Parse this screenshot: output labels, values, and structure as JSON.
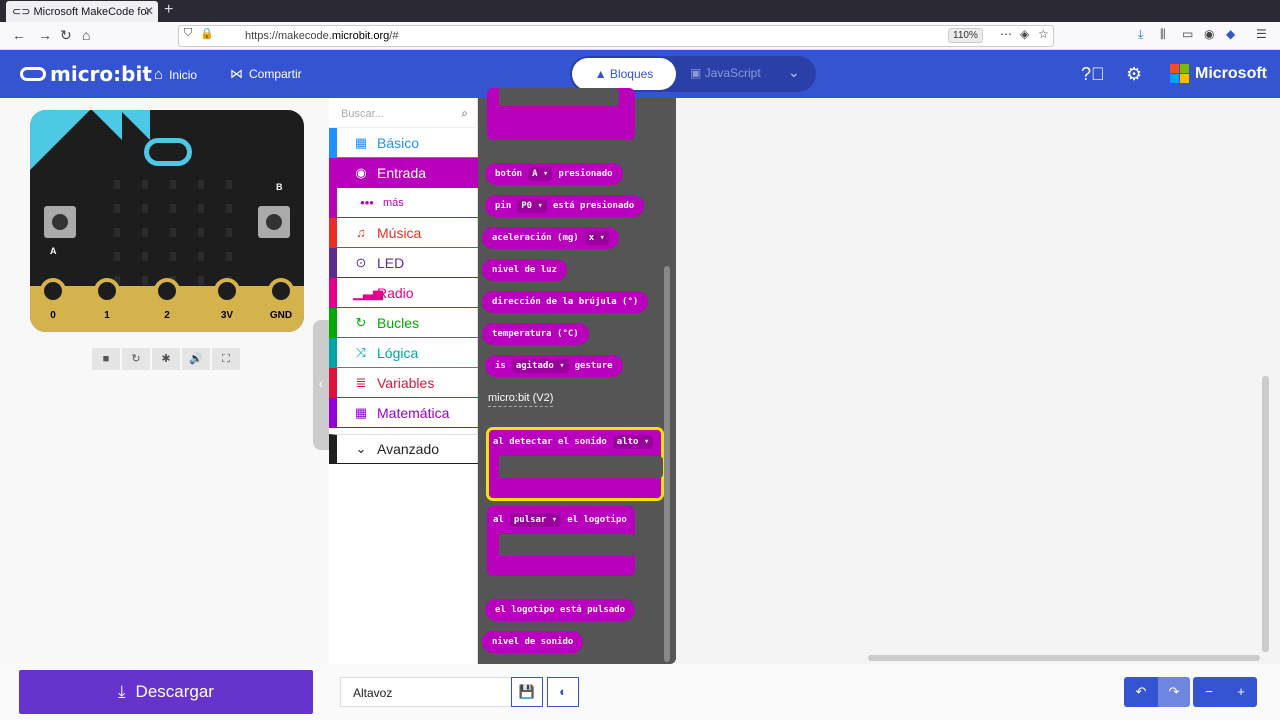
{
  "browser": {
    "tab_title": "Microsoft MakeCode for",
    "url_prefix": "https://makecode.",
    "url_domain": "microbit.org",
    "url_suffix": "/#",
    "zoom": "110%"
  },
  "header": {
    "brand": "micro:bit",
    "home_label": "Inicio",
    "share_label": "Compartir",
    "blocks_label": "Bloques",
    "js_label": "JavaScript",
    "microsoft_label": "Microsoft"
  },
  "simulator": {
    "button_a": "A",
    "button_b": "B",
    "pins": [
      "0",
      "1",
      "2",
      "3V",
      "GND"
    ]
  },
  "toolbox": {
    "search_placeholder": "Buscar...",
    "categories": [
      {
        "label": "Básico",
        "color": "#1e90ff"
      },
      {
        "label": "Entrada",
        "color": "#b900bc"
      },
      {
        "label": "más",
        "color": "#b900bc"
      },
      {
        "label": "Música",
        "color": "#e63022"
      },
      {
        "label": "LED",
        "color": "#5c2d91"
      },
      {
        "label": "Radio",
        "color": "#e3008c"
      },
      {
        "label": "Bucles",
        "color": "#00aa00"
      },
      {
        "label": "Lógica",
        "color": "#00a4a6"
      },
      {
        "label": "Variables",
        "color": "#dc143c"
      },
      {
        "label": "Matemática",
        "color": "#9400d3"
      },
      {
        "label": "Avanzado",
        "color": "#1e1e1e"
      }
    ]
  },
  "flyout": {
    "btn_a": {
      "pre": "botón",
      "dd": "A",
      "post": "presionado"
    },
    "pin": {
      "pre": "pin",
      "dd": "P0",
      "post": "está presionado"
    },
    "accel": {
      "pre": "aceleración (mg)",
      "dd": "x"
    },
    "light": "nivel de luz",
    "compass": "dirección de la brújula (°)",
    "temp": "temperatura (°C)",
    "gesture": {
      "pre": "is",
      "dd": "agitado",
      "post": "gesture"
    },
    "section_v2": "micro:bit (V2)",
    "sound": {
      "pre": "al detectar el sonido",
      "dd": "alto"
    },
    "logo_press": {
      "pre": "al",
      "dd": "pulsar",
      "post": "el logotipo"
    },
    "logo_pressed": "el logotipo está pulsado",
    "sound_level": "nivel de sonido"
  },
  "footer": {
    "download_label": "Descargar",
    "project_name": "Altavoz"
  },
  "colors": {
    "header_bg": "#3454d1",
    "input_category": "#b900bc",
    "download_bg": "#6633cc"
  }
}
